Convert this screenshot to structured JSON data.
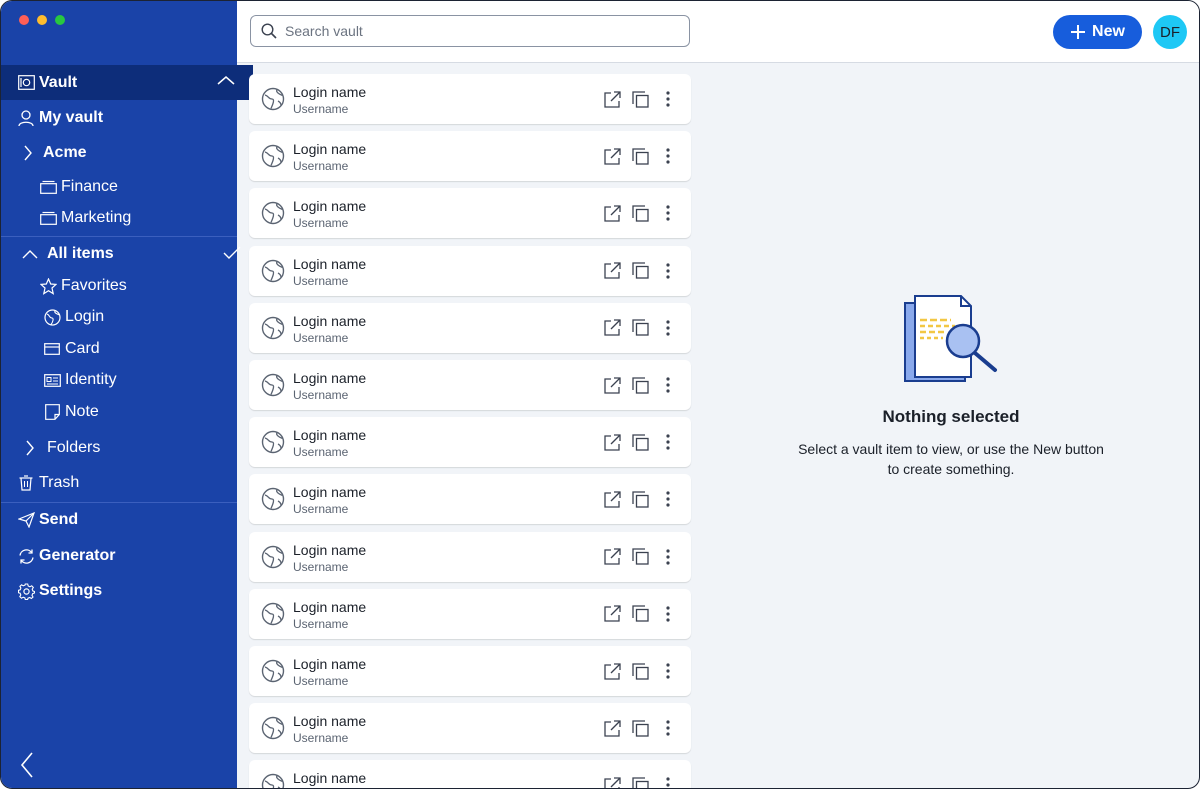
{
  "sidebar": {
    "vault_label": "Vault",
    "my_vault_label": "My vault",
    "org_label": "Acme",
    "collections": [
      "Finance",
      "Marketing"
    ],
    "all_items_label": "All items",
    "types": [
      "Favorites",
      "Login",
      "Card",
      "Identity",
      "Note"
    ],
    "folders_label": "Folders",
    "trash_label": "Trash",
    "send_label": "Send",
    "generator_label": "Generator",
    "settings_label": "Settings"
  },
  "header": {
    "search_placeholder": "Search vault",
    "new_label": "New",
    "avatar_initials": "DF"
  },
  "items": [
    {
      "name": "Login name",
      "username": "Username"
    },
    {
      "name": "Login name",
      "username": "Username"
    },
    {
      "name": "Login name",
      "username": "Username"
    },
    {
      "name": "Login name",
      "username": "Username"
    },
    {
      "name": "Login name",
      "username": "Username"
    },
    {
      "name": "Login name",
      "username": "Username"
    },
    {
      "name": "Login name",
      "username": "Username"
    },
    {
      "name": "Login name",
      "username": "Username"
    },
    {
      "name": "Login name",
      "username": "Username"
    },
    {
      "name": "Login name",
      "username": "Username"
    },
    {
      "name": "Login name",
      "username": "Username"
    },
    {
      "name": "Login name",
      "username": "Username"
    },
    {
      "name": "Login name",
      "username": "Username"
    }
  ],
  "detail": {
    "empty_title": "Nothing selected",
    "empty_line1": "Select a vault item to view, or use the New button",
    "empty_line2": "to create something."
  },
  "colors": {
    "sidebar_bg": "#1a43a8",
    "sidebar_active_bg": "#0d2d7a",
    "accent": "#175ddc",
    "avatar_bg": "#1ec8f5"
  }
}
